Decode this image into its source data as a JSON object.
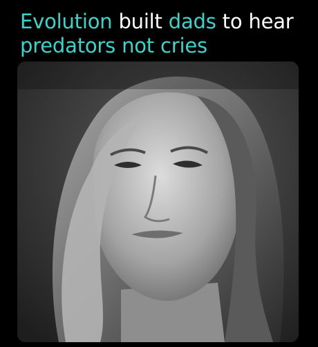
{
  "caption": {
    "line1": [
      {
        "text": "Evolution",
        "style": "highlight"
      },
      {
        "text": " built ",
        "style": "plain"
      },
      {
        "text": "dads",
        "style": "highlight"
      },
      {
        "text": " to hear",
        "style": "plain"
      }
    ],
    "line2": [
      {
        "text": "predators not cries",
        "style": "highlight"
      }
    ]
  },
  "video": {
    "subject": "woman-speaking-portrait"
  },
  "colors": {
    "background": "#000000",
    "highlight": "#37d6cc",
    "plain_text": "#ffffff"
  }
}
